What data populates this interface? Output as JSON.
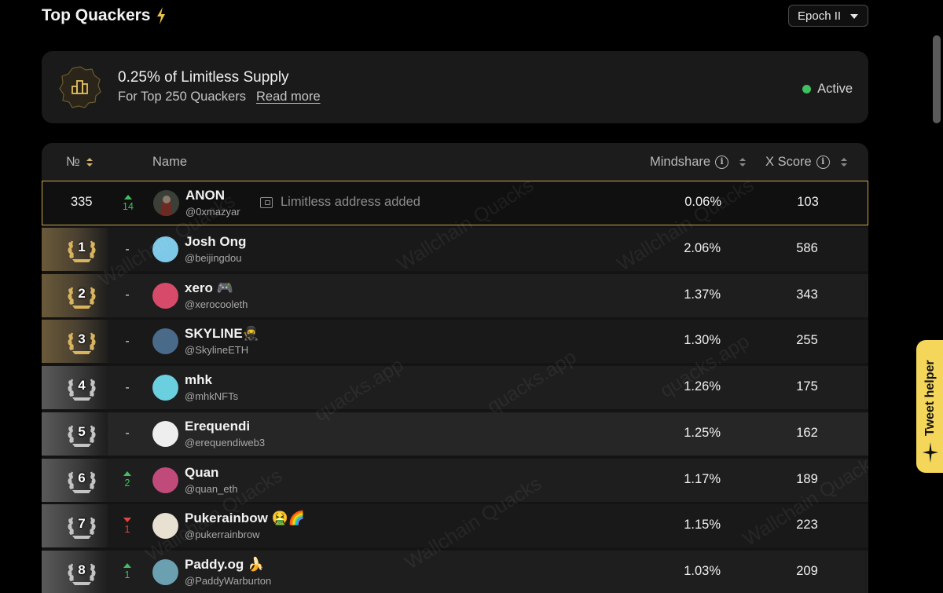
{
  "header": {
    "title": "Top Quackers",
    "epoch": "Epoch II"
  },
  "banner": {
    "title": "0.25% of Limitless Supply",
    "subtitle": "For Top 250 Quackers",
    "read_more": "Read more",
    "status": "Active"
  },
  "table": {
    "col_rank": "№",
    "col_name": "Name",
    "col_mindshare": "Mindshare",
    "col_xscore": "X Score",
    "current_user": {
      "rank": "335",
      "change": "14",
      "name": "ANON",
      "handle": "@0xmazyar",
      "note": "Limitless address added",
      "mindshare": "0.06%",
      "xscore": "103"
    },
    "rows": [
      {
        "rank": "1",
        "change": "-",
        "name": "Josh Ong",
        "handle": "@beijingdou",
        "mindshare": "2.06%",
        "xscore": "586"
      },
      {
        "rank": "2",
        "change": "-",
        "name": "xero 🎮",
        "handle": "@xerocooleth",
        "mindshare": "1.37%",
        "xscore": "343"
      },
      {
        "rank": "3",
        "change": "-",
        "name": "SKYLINE🥷",
        "handle": "@SkylineETH",
        "mindshare": "1.30%",
        "xscore": "255"
      },
      {
        "rank": "4",
        "change": "-",
        "name": "mhk",
        "handle": "@mhkNFTs",
        "mindshare": "1.26%",
        "xscore": "175"
      },
      {
        "rank": "5",
        "change": "-",
        "name": "Erequendi",
        "handle": "@erequendiweb3",
        "mindshare": "1.25%",
        "xscore": "162"
      },
      {
        "rank": "6",
        "change": "2",
        "name": "Quan",
        "handle": "@quan_eth",
        "mindshare": "1.17%",
        "xscore": "189"
      },
      {
        "rank": "7",
        "change": "1",
        "name": "Pukerainbow 🤮🌈",
        "handle": "@pukerrainbrow",
        "mindshare": "1.15%",
        "xscore": "223"
      },
      {
        "rank": "8",
        "change": "1",
        "name": "Paddy.og 🍌",
        "handle": "@PaddyWarburton",
        "mindshare": "1.03%",
        "xscore": "209"
      }
    ]
  },
  "watermarks": [
    "Wallchain Quacks",
    "quacks.app"
  ],
  "tweet_helper": "Tweet helper",
  "colors": {
    "gold": "#c8a449",
    "up": "#3fbf5f",
    "down": "#e04545",
    "active": "#3fbf5f",
    "helper": "#f3d65a"
  }
}
